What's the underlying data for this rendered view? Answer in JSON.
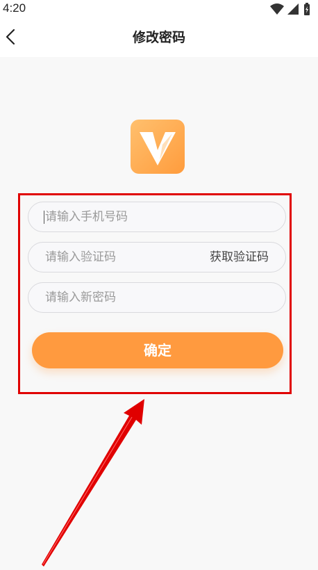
{
  "status_bar": {
    "time": "4:20"
  },
  "header": {
    "title": "修改密码"
  },
  "form": {
    "phone_placeholder": "请输入手机号码",
    "code_placeholder": "请输入验证码",
    "get_code_label": "获取验证码",
    "new_password_placeholder": "请输入新密码",
    "confirm_label": "确定"
  },
  "icons": {
    "back": "chevron-left-icon",
    "logo": "app-logo-v-icon",
    "wifi": "wifi-icon",
    "signal": "signal-icon",
    "battery": "battery-charging-icon"
  },
  "colors": {
    "accent": "#ff9a3f",
    "annotation": "#e00000"
  }
}
